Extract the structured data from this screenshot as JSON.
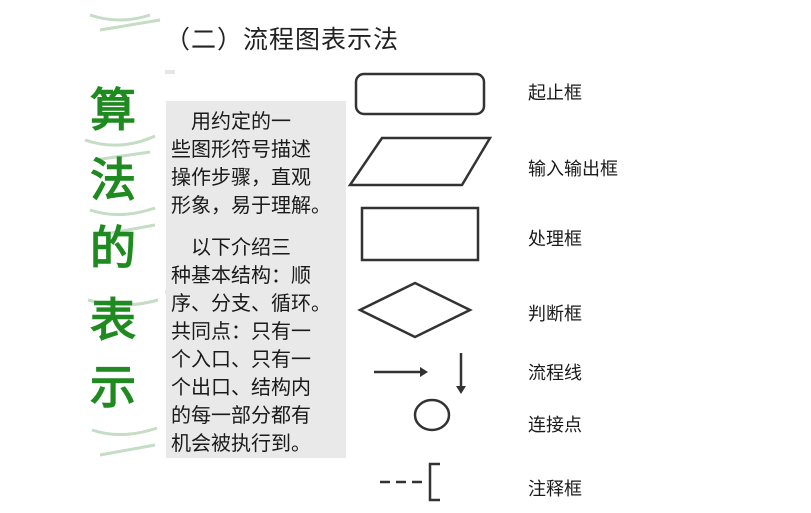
{
  "title": "（二）流程图表示法",
  "side_title": [
    "算",
    "法",
    "的",
    "表",
    "示"
  ],
  "description": {
    "para1": [
      "　用约定的一",
      "些图形符号描述",
      "操作步骤，直观",
      "形象，易于理解。"
    ],
    "para2": [
      "　以下介绍三",
      "种基本结构：顺",
      "序、分支、循环。",
      "共同点：只有一",
      "个入口、只有一",
      "个出口、结构内",
      "的每一部分都有",
      "机会被执行到。"
    ]
  },
  "symbols": [
    {
      "icon": "terminal-rounded-rectangle",
      "label": "起止框"
    },
    {
      "icon": "io-parallelogram",
      "label": "输入输出框"
    },
    {
      "icon": "process-rectangle",
      "label": "处理框"
    },
    {
      "icon": "decision-diamond",
      "label": "判断框"
    },
    {
      "icon": "flow-arrows",
      "label": "流程线"
    },
    {
      "icon": "connector-circle",
      "label": "连接点"
    },
    {
      "icon": "annotation-bracket",
      "label": "注释框"
    }
  ],
  "colors": {
    "side_title": "#1f8a1f",
    "textbox_bg": "#e9e9e9",
    "stroke": "#333333"
  }
}
